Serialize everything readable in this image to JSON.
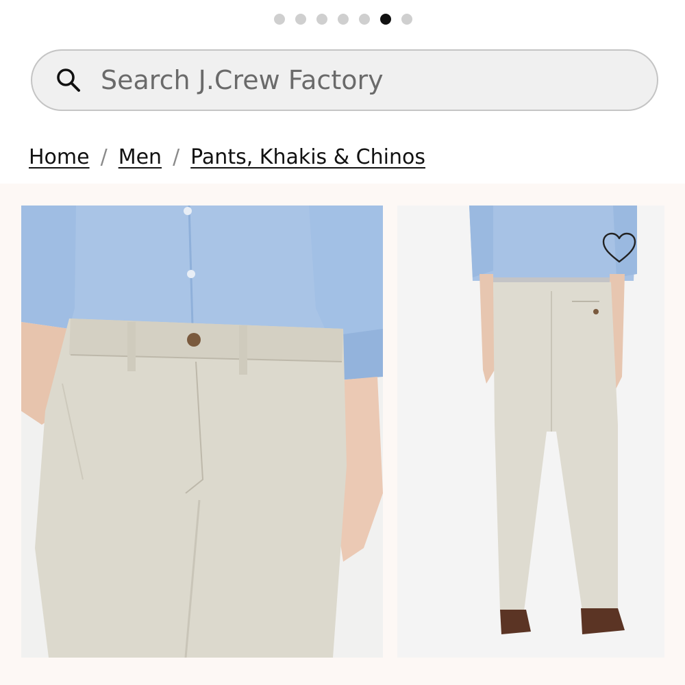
{
  "carousel": {
    "dot_count": 7,
    "active_index": 5
  },
  "search": {
    "placeholder": "Search J.Crew Factory",
    "value": "",
    "icon": "search-icon"
  },
  "breadcrumb": {
    "items": [
      {
        "label": "Home"
      },
      {
        "label": "Men"
      },
      {
        "label": "Pants, Khakis & Chinos"
      }
    ],
    "separator": "/"
  },
  "gallery": {
    "images": [
      {
        "subject": "front close-up of stone chino pants with blue oxford shirt"
      },
      {
        "subject": "back full-length view of stone chino pants with brown shoes"
      }
    ],
    "wishlist_icon": "heart-outline-icon"
  },
  "colors": {
    "pants": "#dcd8cc",
    "shirt": "#a7c3e6",
    "page_band": "#fdf8f5",
    "active_dot": "#111111",
    "inactive_dot": "#cfcfcf"
  }
}
